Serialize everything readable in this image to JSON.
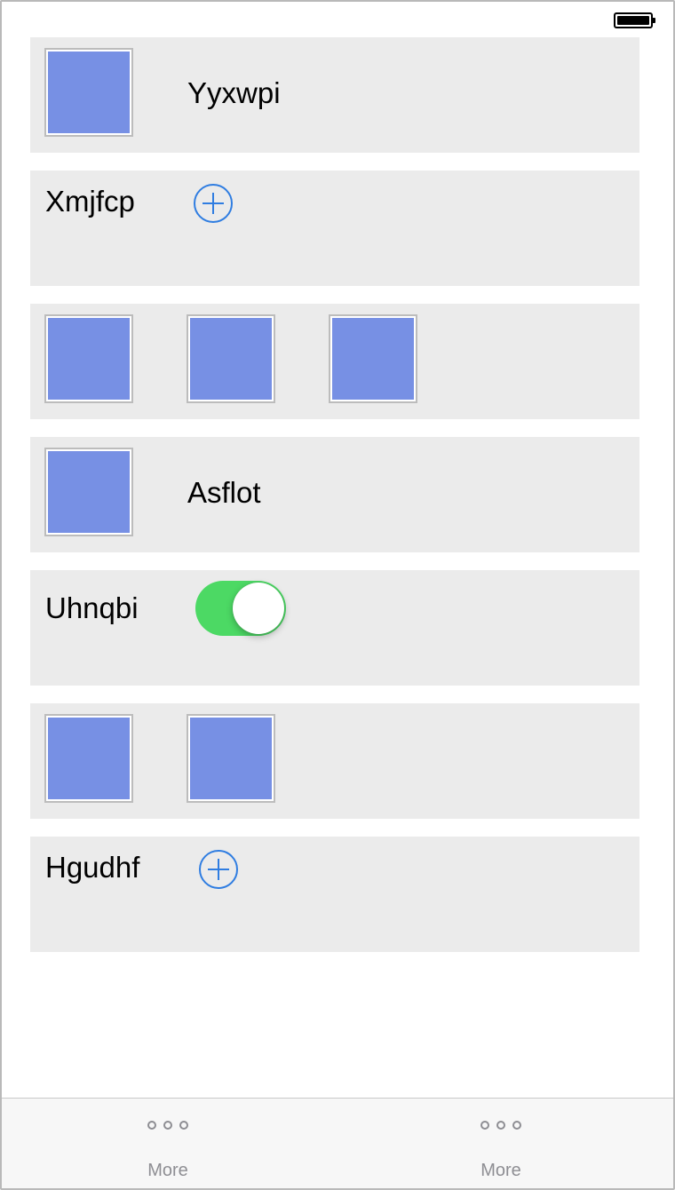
{
  "status_bar": {
    "battery_icon": "battery-full-icon"
  },
  "rows": [
    {
      "type": "image-label",
      "label": "Yyxwpi"
    },
    {
      "type": "label-add",
      "label": "Xmjfcp",
      "icon": "plus-circle-icon"
    },
    {
      "type": "images",
      "count": 3
    },
    {
      "type": "image-label",
      "label": "Asflot"
    },
    {
      "type": "label-toggle",
      "label": "Uhnqbi",
      "toggle_on": true
    },
    {
      "type": "images",
      "count": 2
    },
    {
      "type": "label-add",
      "label": "Hgudhf",
      "icon": "plus-circle-icon"
    }
  ],
  "tab_bar": {
    "tabs": [
      {
        "label": "More",
        "icon": "more-dots-icon"
      },
      {
        "label": "More",
        "icon": "more-dots-icon"
      }
    ]
  },
  "colors": {
    "row_background": "#ebebeb",
    "image_fill": "#7790e4",
    "accent_blue": "#2f7de1",
    "toggle_green": "#4cd964",
    "tab_label_gray": "#8e8e93"
  }
}
